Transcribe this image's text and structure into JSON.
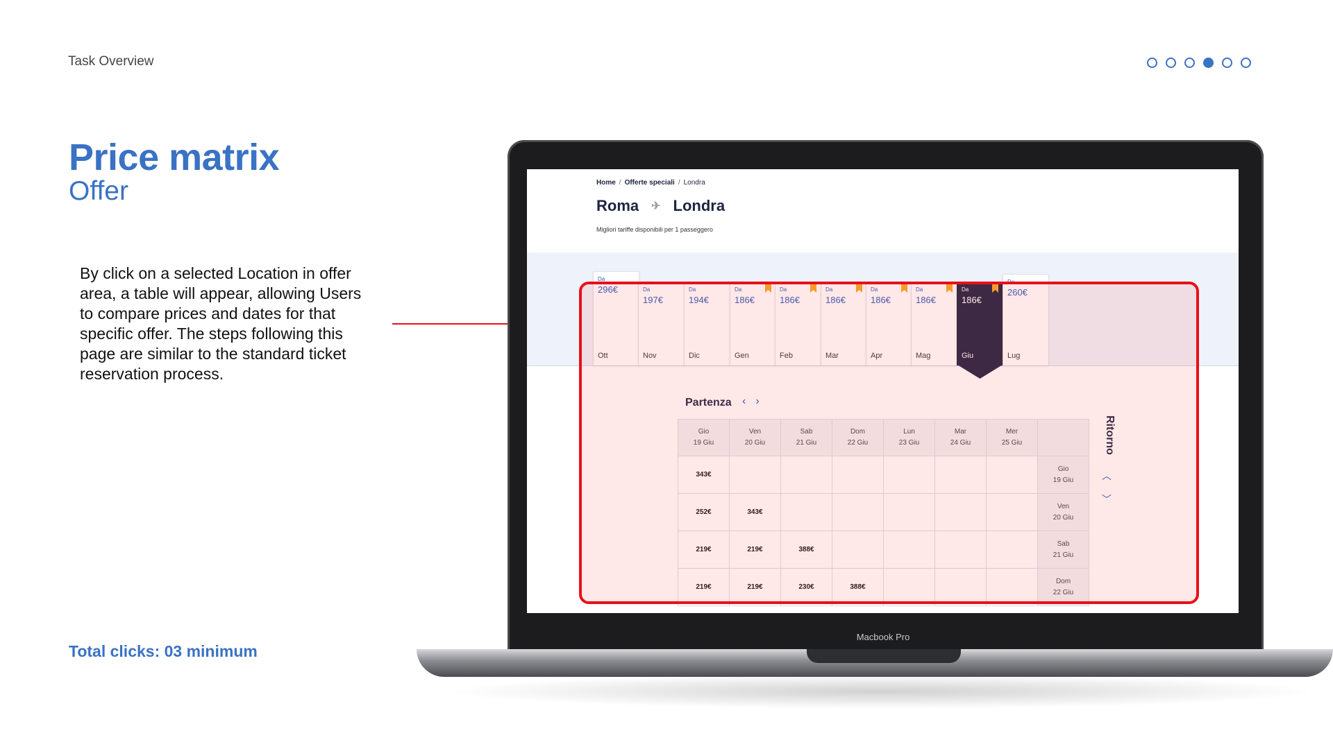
{
  "header": {
    "task_overview": "Task Overview",
    "steps_total": 6,
    "active_step": 4
  },
  "slide": {
    "title": "Price matrix",
    "subtitle": "Offer",
    "description": "By click on a selected  Location in offer area, a table will appear, allowing Users to compare prices and dates for that specific offer. The steps following this page are similar to the standard ticket reservation process.",
    "total_clicks": "Total clicks: 03  minimum",
    "arrow_color": "#e8101a",
    "accent_color": "#3a72c4"
  },
  "laptop": {
    "label": "Macbook Pro"
  },
  "site": {
    "breadcrumb": {
      "home": "Home",
      "offers": "Offerte speciali",
      "current": "Londra",
      "separator": "/"
    },
    "route": {
      "from": "Roma",
      "to": "Londra",
      "plane_icon": "plane-icon"
    },
    "route_subtitle": "Migliori tariffe disponibili per 1 passeggero",
    "months": [
      {
        "da": "Da",
        "price": "296€",
        "month": "Ott",
        "bookmark": false,
        "selected": false
      },
      {
        "da": "Da",
        "price": "197€",
        "month": "Nov",
        "bookmark": false,
        "selected": false
      },
      {
        "da": "Da",
        "price": "194€",
        "month": "Dic",
        "bookmark": false,
        "selected": false
      },
      {
        "da": "Da",
        "price": "186€",
        "month": "Gen",
        "bookmark": true,
        "selected": false
      },
      {
        "da": "Da",
        "price": "186€",
        "month": "Feb",
        "bookmark": true,
        "selected": false
      },
      {
        "da": "Da",
        "price": "186€",
        "month": "Mar",
        "bookmark": true,
        "selected": false
      },
      {
        "da": "Da",
        "price": "186€",
        "month": "Apr",
        "bookmark": true,
        "selected": false
      },
      {
        "da": "Da",
        "price": "186€",
        "month": "Mag",
        "bookmark": true,
        "selected": false
      },
      {
        "da": "Da",
        "price": "186€",
        "month": "Giu",
        "bookmark": true,
        "selected": true
      },
      {
        "da": "Da",
        "price": "260€",
        "month": "Lug",
        "bookmark": false,
        "selected": false
      }
    ],
    "partenza_label": "Partenza",
    "ritorno_label": "Ritorno",
    "departure_days": [
      {
        "day": "Gio",
        "date": "19 Giu"
      },
      {
        "day": "Ven",
        "date": "20 Giu"
      },
      {
        "day": "Sab",
        "date": "21 Giu"
      },
      {
        "day": "Dom",
        "date": "22 Giu"
      },
      {
        "day": "Lun",
        "date": "23 Giu"
      },
      {
        "day": "Mar",
        "date": "24 Giu"
      },
      {
        "day": "Mer",
        "date": "25 Giu"
      }
    ],
    "return_rows": [
      {
        "day": "Gio",
        "date": "19 Giu",
        "prices": [
          "343€",
          "",
          "",
          "",
          "",
          "",
          ""
        ]
      },
      {
        "day": "Ven",
        "date": "20 Giu",
        "prices": [
          "252€",
          "343€",
          "",
          "",
          "",
          "",
          ""
        ]
      },
      {
        "day": "Sab",
        "date": "21 Giu",
        "prices": [
          "219€",
          "219€",
          "388€",
          "",
          "",
          "",
          ""
        ]
      },
      {
        "day": "Dom",
        "date": "22 Giu",
        "prices": [
          "219€",
          "219€",
          "230€",
          "388€",
          "",
          "",
          ""
        ]
      }
    ]
  }
}
